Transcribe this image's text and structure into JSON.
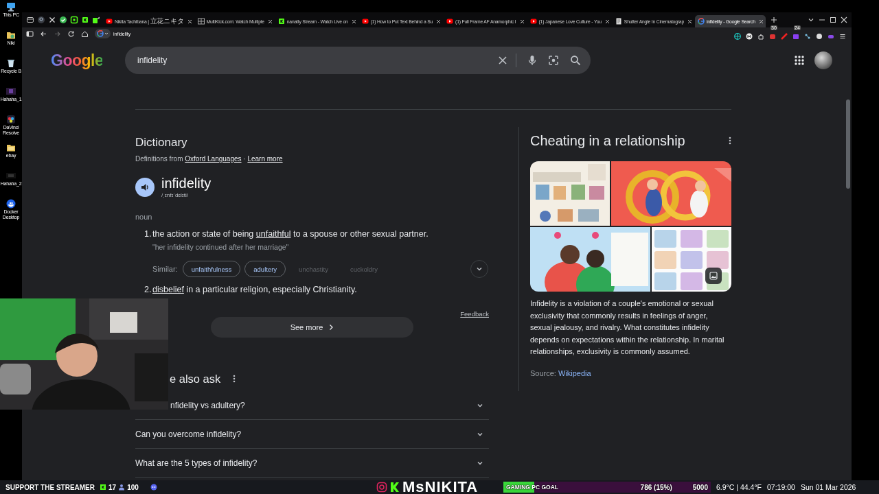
{
  "desktop": {
    "icons": [
      {
        "label": "This PC"
      },
      {
        "label": "Niki"
      },
      {
        "label": "Recycle B"
      },
      {
        "label": "Hahaha_1"
      },
      {
        "label": "DaVinci Resolve"
      },
      {
        "label": "ebay"
      },
      {
        "label": "Hahaha_2"
      },
      {
        "label": "Docker Desktop"
      }
    ]
  },
  "browser": {
    "tabs": [
      {
        "title": "Nikita Tachibana | 立花ニキタ",
        "selected": false
      },
      {
        "title": "MultiKick.com: Watch Multiple",
        "selected": false
      },
      {
        "title": "nanatty Stream - Watch Live on",
        "selected": false
      },
      {
        "title": "(1) How to Put Text Behind a Su",
        "selected": false
      },
      {
        "title": "(1) Full Frame AF Anamorphic I",
        "selected": false
      },
      {
        "title": "(1) Japanese Love Culture - You",
        "selected": false
      },
      {
        "title": "Shutter Angle In Cinematograp",
        "selected": false
      },
      {
        "title": "infidelity - Google Search",
        "selected": true
      }
    ],
    "address": "infidelity",
    "extension_badges": [
      "30",
      "24"
    ]
  },
  "google": {
    "logo": "Google",
    "search": {
      "value": "infidelity"
    },
    "dictionary": {
      "heading": "Dictionary",
      "source_parts": [
        {
          "text": "Definitions from "
        },
        {
          "text": "Oxford Languages",
          "link": true
        },
        {
          "text": " · "
        },
        {
          "text": "Learn more",
          "link": true
        }
      ],
      "word": "infidelity",
      "phonetic": "/ˌɪnfɪˈdɛlɪti/",
      "part_of_speech": "noun",
      "senses": [
        {
          "number": "1.",
          "parts": [
            {
              "text": "the action or state of being "
            },
            {
              "text": "unfaithful",
              "link": true
            },
            {
              "text": " to a spouse or other sexual partner."
            }
          ],
          "example": "\"her infidelity continued after her marriage\"",
          "similar_label": "Similar:",
          "similar": [
            {
              "text": "unfaithfulness",
              "linked": true
            },
            {
              "text": "adultery",
              "linked": true
            },
            {
              "text": "unchastity",
              "linked": false
            },
            {
              "text": "cuckoldry",
              "linked": false
            }
          ]
        },
        {
          "number": "2.",
          "parts": [
            {
              "text": "disbelief",
              "link": true
            },
            {
              "text": " in a particular religion, especially Christianity."
            }
          ]
        }
      ],
      "feedback": "Feedback",
      "see_more": "See more"
    },
    "people_also_ask": {
      "heading": "e also ask",
      "questions": [
        "nfidelity vs adultery?",
        "Can you overcome infidelity?",
        "What are the 5 types of infidelity?"
      ]
    },
    "knowledge_panel": {
      "title": "Cheating in a relationship",
      "description": "Infidelity is a violation of a couple's emotional or sexual exclusivity that commonly results in feelings of anger, sexual jealousy, and rivalry. What constitutes infidelity depends on expectations within the relationship. In marital relationships, exclusivity is commonly assumed.",
      "source_label": "Source: ",
      "source_link": "Wikipedia"
    }
  },
  "stream_overlay": {
    "support": "SUPPORT THE STREAMER",
    "count_1": "17",
    "count_2": "100",
    "channel": "MsNIKITA",
    "goal": {
      "label": "GAMING PC GOAL",
      "progress": "786 (15%)",
      "target": "5000",
      "level": 0.15
    },
    "weather": "6.9°C | 44.4°F",
    "time": "07:19:00",
    "date": "Sun 01 Mar 2026"
  }
}
